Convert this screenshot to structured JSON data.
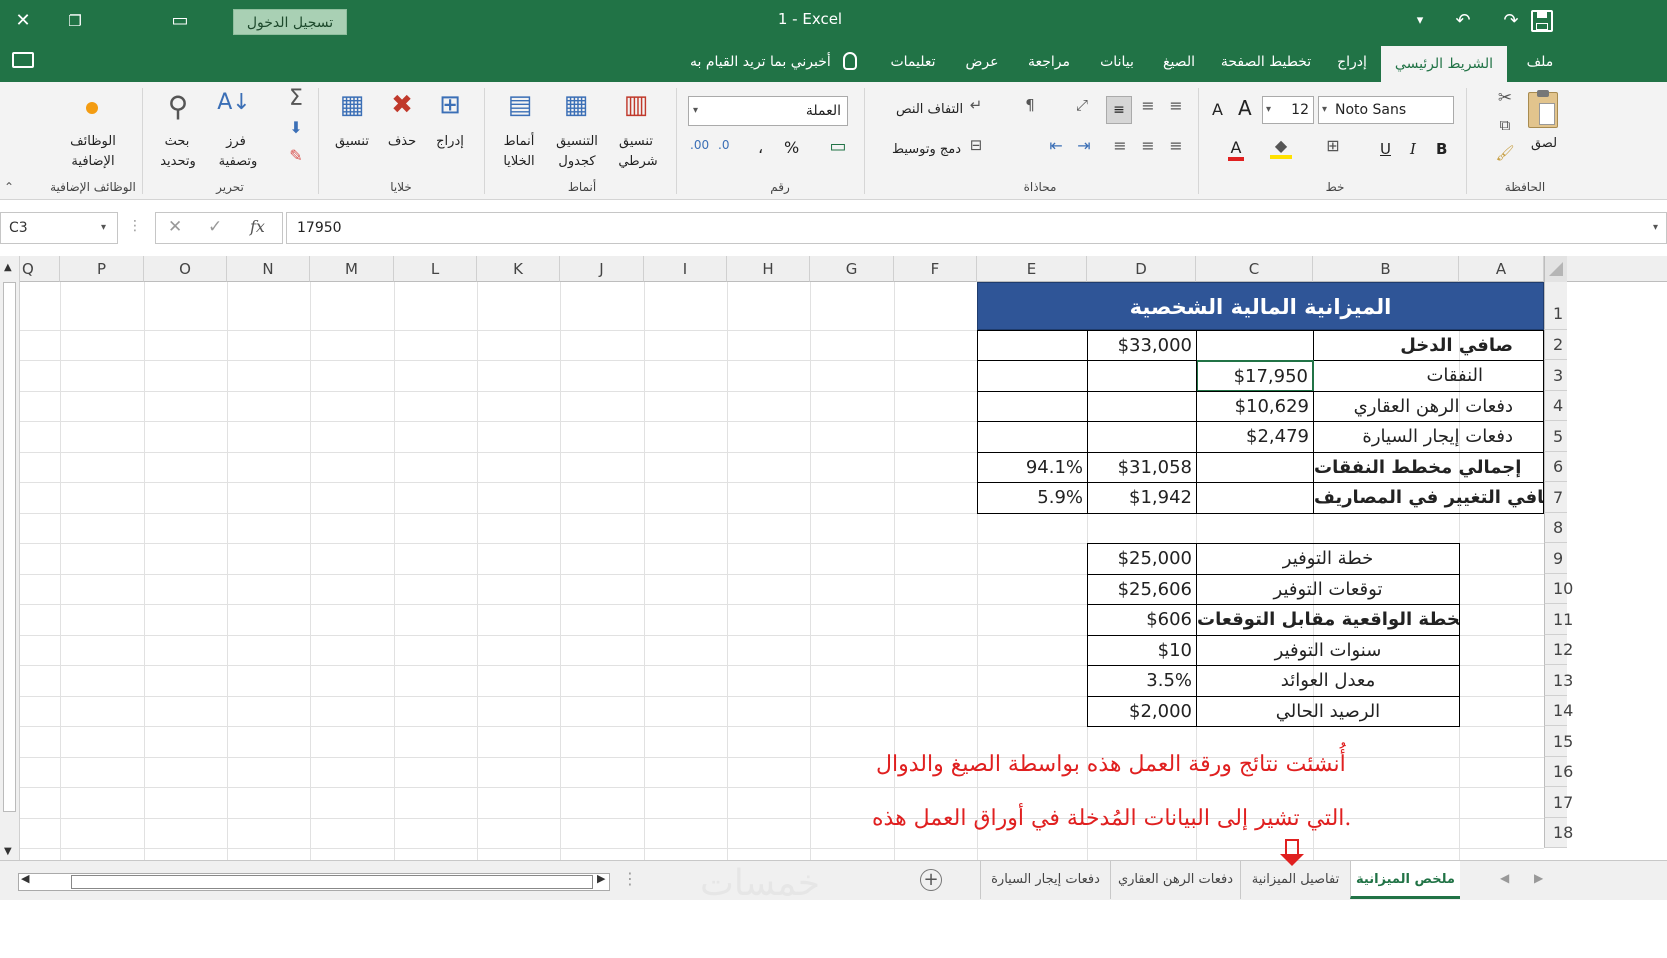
{
  "window": {
    "title": "1  -  Excel",
    "sign_in": "تسجيل الدخول",
    "close_glyph": "✕",
    "restore_glyph": "❐",
    "ribbon_display_glyph": "▭",
    "save_glyph": "🖫",
    "undo_glyph": "↶",
    "redo_glyph": "↷",
    "qat_more_glyph": "▾"
  },
  "tabs": [
    "ملف",
    "الشريط الرئيسي",
    "إدراج",
    "تخطيط الصفحة",
    "الصيغ",
    "بيانات",
    "مراجعة",
    "عرض",
    "تعليمات"
  ],
  "active_tab": "الشريط الرئيسي",
  "tell_me": "أخبرني بما تريد القيام به",
  "ribbon": {
    "clipboard": {
      "label": "الحافظة",
      "paste": "لصق"
    },
    "font": {
      "label": "خط",
      "name": "Noto Sans",
      "size": "12",
      "bold": "B",
      "italic": "I",
      "underline": "U",
      "grow": "A",
      "shrink": "A"
    },
    "alignment": {
      "label": "محاذاة",
      "wrap": "التفاف النص",
      "merge": "دمج وتوسيط"
    },
    "number": {
      "label": "رقم",
      "format": "العملة",
      "percent": "%",
      "comma": "،"
    },
    "styles": {
      "label": "أنماط",
      "conditional_1": "تنسيق",
      "conditional_2": "شرطي",
      "table_1": "التنسيق",
      "table_2": "كجدول",
      "cell_1": "أنماط",
      "cell_2": "الخلايا"
    },
    "cells": {
      "label": "خلايا",
      "insert": "إدراج",
      "delete": "حذف",
      "format": "تنسيق"
    },
    "editing": {
      "label": "تحرير",
      "sort_1": "فرز",
      "sort_2": "وتصفية",
      "find_1": "بحث",
      "find_2": "وتحديد",
      "sum": "Σ"
    },
    "addins": {
      "label": "الوظائف الإضافية",
      "name_1": "الوظائف",
      "name_2": "الإضافية"
    }
  },
  "formula_bar": {
    "name_box": "C3",
    "value": "17950",
    "fx": "fx",
    "cancel": "✕",
    "enter": "✓"
  },
  "columns": [
    "A",
    "B",
    "C",
    "D",
    "E",
    "F",
    "G",
    "H",
    "I",
    "J",
    "K",
    "L",
    "M",
    "N",
    "O",
    "P",
    "Q"
  ],
  "rows": [
    "1",
    "2",
    "3",
    "4",
    "5",
    "6",
    "7",
    "8",
    "9",
    "10",
    "11",
    "12",
    "13",
    "14",
    "15",
    "16",
    "17",
    "18"
  ],
  "sheet": {
    "title": "الميزانية المالية الشخصية",
    "net_income_label": "صافي الدخل",
    "net_income": "$33,000",
    "expenses_label": "النفقات",
    "expenses": "$17,950",
    "mortgage_label": "دفعات الرهن العقاري",
    "mortgage": "$10,629",
    "car_label": "دفعات إيجار السيارة",
    "car": "$2,479",
    "total_planned_label": "إجمالي مخطط النفقات",
    "total_planned": "$31,058",
    "total_planned_pct": "94.1%",
    "net_change_label": "صافي التغيير في المصاريف",
    "net_change": "$1,942",
    "net_change_pct": "5.9%",
    "savings": [
      {
        "label": "خطة التوفير",
        "value": "$25,000",
        "bold": false
      },
      {
        "label": "توقعات التوفير",
        "value": "$25,606",
        "bold": false
      },
      {
        "label": "الخطة الواقعية مقابل التوقعات",
        "value": "$606",
        "bold": true
      },
      {
        "label": "سنوات التوفير",
        "value": "$10",
        "bold": false
      },
      {
        "label": "معدل العوائد",
        "value": "3.5%",
        "bold": false
      },
      {
        "label": "الرصيد الحالي",
        "value": "$2,000",
        "bold": false
      }
    ]
  },
  "annotation": {
    "line1": "أُنشئت نتائج ورقة العمل هذه بواسطة الصيغ والدوال",
    "line2": "التي تشير إلى البيانات المُدخلة في أوراق العمل هذه."
  },
  "sheet_tabs": [
    "ملخص الميزانية",
    "تفاصيل الميزانية",
    "دفعات الرهن العقاري",
    "دفعات إيجار السيارة"
  ],
  "active_sheet": "ملخص الميزانية",
  "watermark": "خمسات",
  "colors": {
    "excel_green": "#217346",
    "header_blue": "#2f5597",
    "annotation_red": "#e02020"
  }
}
